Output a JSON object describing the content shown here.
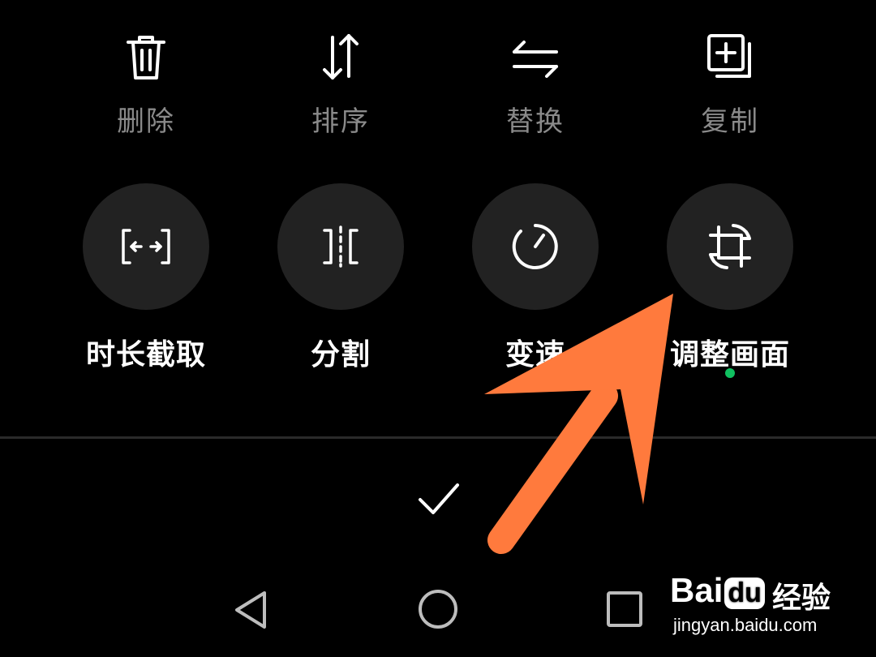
{
  "toolbar_top": [
    {
      "label": "删除",
      "icon": "trash-icon"
    },
    {
      "label": "排序",
      "icon": "sort-arrows-icon"
    },
    {
      "label": "替换",
      "icon": "replace-arrows-icon"
    },
    {
      "label": "复制",
      "icon": "copy-add-icon"
    }
  ],
  "toolbar_tools": [
    {
      "label": "时长截取",
      "icon": "trim-duration-icon"
    },
    {
      "label": "分割",
      "icon": "split-icon"
    },
    {
      "label": "变速",
      "icon": "speedometer-icon"
    },
    {
      "label": "调整画面",
      "icon": "crop-rotate-icon"
    }
  ],
  "confirm_icon": "checkmark-icon",
  "nav": [
    "back-triangle-icon",
    "home-circle-icon",
    "recents-square-icon"
  ],
  "colors": {
    "background": "#000000",
    "secondary_label": "#8a8a8a",
    "tool_circle": "#222222",
    "new_dot": "#10c060",
    "annotation_arrow": "#ff7a3d"
  },
  "watermark": {
    "brand_prefix": "Bai",
    "brand_du": "du",
    "brand_cn": "经验",
    "url": "jingyan.baidu.com"
  }
}
